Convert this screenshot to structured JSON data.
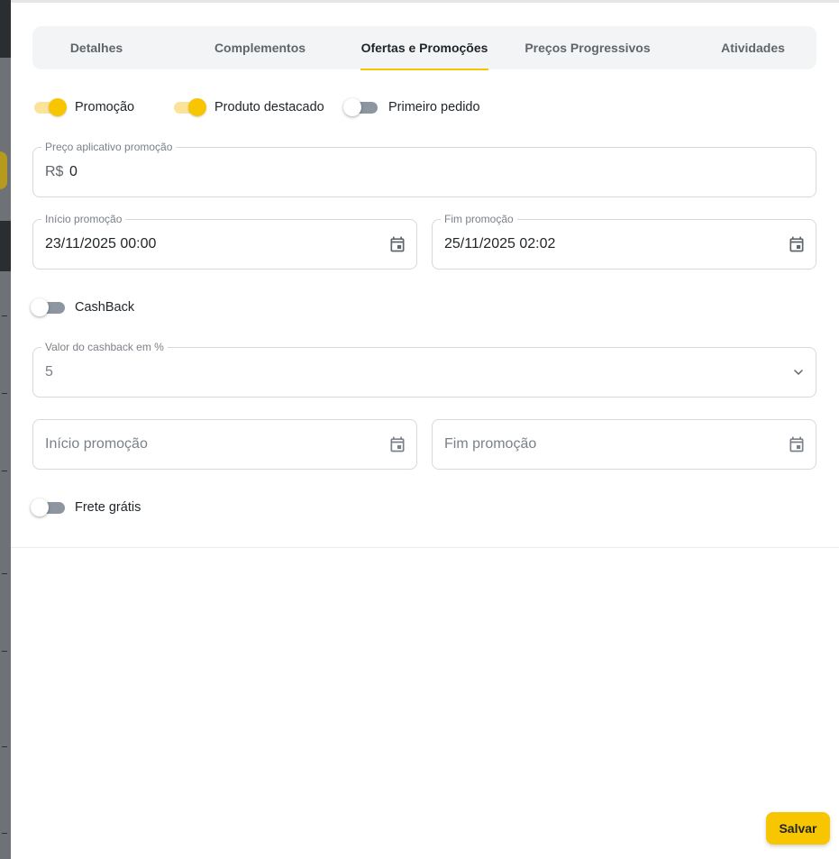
{
  "tabs": [
    {
      "label": "Detalhes",
      "active": false
    },
    {
      "label": "Complementos",
      "active": false
    },
    {
      "label": "Ofertas e Promoções",
      "active": true
    },
    {
      "label": "Preços Progressivos",
      "active": false
    },
    {
      "label": "Atividades",
      "active": false
    }
  ],
  "toggles": {
    "promocao": {
      "label": "Promoção",
      "checked": true
    },
    "produto_destacado": {
      "label": "Produto destacado",
      "checked": true
    },
    "primeiro_pedido": {
      "label": "Primeiro pedido",
      "checked": false
    },
    "cashback": {
      "label": "CashBack",
      "checked": false
    },
    "frete_gratis": {
      "label": "Frete grátis",
      "checked": false
    }
  },
  "preco_promocao": {
    "label": "Preço aplicativo promoção",
    "prefix": "R$",
    "value": "0"
  },
  "promo_dates": {
    "inicio": {
      "label": "Início promoção",
      "value": "23/11/2025 00:00"
    },
    "fim": {
      "label": "Fim promoção",
      "value": "25/11/2025 02:02"
    }
  },
  "cashback_percent": {
    "label": "Valor do cashback em %",
    "value": "5"
  },
  "cashback_dates": {
    "inicio": {
      "placeholder": "Início promoção"
    },
    "fim": {
      "placeholder": "Fim promoção"
    }
  },
  "save_label": "Salvar",
  "colors": {
    "accent": "#f7c600",
    "accent_light": "#fbe39a",
    "switch_off": "#8d96a0"
  }
}
